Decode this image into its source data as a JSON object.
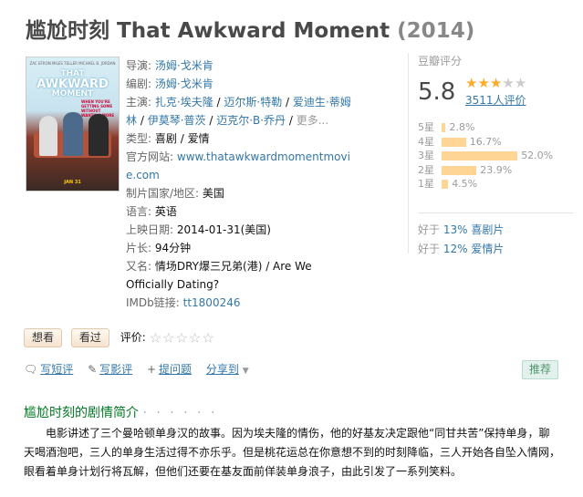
{
  "title": {
    "cn": "尴尬时刻",
    "en": "That Awkward Moment",
    "year": "(2014)"
  },
  "poster": {
    "names": "ZAC EFRON   MILES TELLER   MICHAEL B. JORDAN",
    "line1": "THAT",
    "line2": "AWKWARD",
    "line3": "MOMENT",
    "tagline": "WHEN YOU'RE GETTING SOME WITHOUT WANTING MORE",
    "date": "JAN 31"
  },
  "info": {
    "director_label": "导演:",
    "director": "汤姆·戈米肯",
    "writer_label": "编剧:",
    "writer": "汤姆·戈米肯",
    "cast_label": "主演:",
    "cast": [
      "扎克·埃夫隆",
      "迈尔斯·特勒",
      "爱迪生·蒂姆林",
      "伊莫琴·普茨",
      "迈克尔·B·乔丹",
      "更多..."
    ],
    "genre_label": "类型:",
    "genres": [
      "喜剧",
      "爱情"
    ],
    "site_label": "官方网站:",
    "site": "www.thatawkwardmomentmovie.com",
    "country_label": "制片国家/地区:",
    "country": "美国",
    "language_label": "语言:",
    "language": "英语",
    "release_label": "上映日期:",
    "release": "2014-01-31(美国)",
    "runtime_label": "片长:",
    "runtime": "94分钟",
    "aka_label": "又名:",
    "aka": "情场DRY爆三兄弟(港) / Are We Officially Dating?",
    "imdb_label": "IMDb链接:",
    "imdb": "tt1800246"
  },
  "rating": {
    "header": "豆瓣评分",
    "score": "5.8",
    "stars": 3,
    "votes": "3511人评价",
    "distribution": [
      {
        "label": "5星",
        "pct": "2.8%",
        "value": 2.8
      },
      {
        "label": "4星",
        "pct": "16.7%",
        "value": 16.7
      },
      {
        "label": "3星",
        "pct": "52.0%",
        "value": 52.0
      },
      {
        "label": "2星",
        "pct": "23.9%",
        "value": 23.9
      },
      {
        "label": "1星",
        "pct": "4.5%",
        "value": 4.5
      }
    ],
    "better_than": [
      {
        "prefix": "好于",
        "pct": "13%",
        "genre": "喜剧片"
      },
      {
        "prefix": "好于",
        "pct": "12%",
        "genre": "爱情片"
      }
    ]
  },
  "actions": {
    "want": "想看",
    "seen": "看过",
    "rate_label": "评价:",
    "empty_stars": "☆☆☆☆☆"
  },
  "tools": {
    "short_review": "写短评",
    "review": "写影评",
    "ask": "提问题",
    "share": "分享到",
    "recommend": "推荐"
  },
  "synopsis": {
    "title": "尴尬时刻的剧情简介",
    "dots": "· · · · · ·",
    "text": "电影讲述了三个曼哈顿单身汉的故事。因为埃夫隆的情伤，他的好基友决定跟他“同甘共苦”保持单身，聊天喝酒泡吧，三人的单身生活过得不亦乐乎。但是桃花运总在你意想不到的时刻降临，三人开始各自坠入情网，眼看着单身计划行将瓦解，但他们还要在基友面前佯装单身浪子，由此引发了一系列笑料。"
  },
  "colors": {
    "link": "#3377aa",
    "star": "#ffac2d",
    "bar": "#ffd596",
    "green_title": "#007722"
  }
}
